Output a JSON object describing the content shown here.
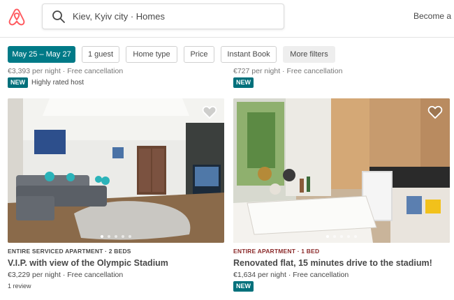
{
  "colors": {
    "brand": "#ff5a5f",
    "accent": "#007a87",
    "badge": "#00707b"
  },
  "header": {
    "logo_icon": "airbnb-logo",
    "search_icon": "search-icon",
    "search_value": "Kiev, Kyiv city · Homes",
    "become_host": "Become a h"
  },
  "filters": {
    "dates": "May 25 – May 27",
    "guests": "1 guest",
    "home_type": "Home type",
    "price": "Price",
    "instant_book": "Instant Book",
    "more_filters": "More filters"
  },
  "prev_listings": [
    {
      "price_line": "€3,393 per night · Free cancellation",
      "badge": "NEW",
      "note": "Highly rated host"
    },
    {
      "price_line": "€727 per night · Free cancellation",
      "badge": "NEW"
    }
  ],
  "listings": [
    {
      "type": "ENTIRE SERVICED APARTMENT · 2 BEDS",
      "type_color": "#484848",
      "title": "V.I.P. with view of the Olympic Stadium",
      "price": "€3,229",
      "price_suffix": "per night · Free cancellation",
      "reviews": "1 review",
      "photo_count": 5,
      "active_photo": 0
    },
    {
      "type": "ENTIRE APARTMENT · 1 BED",
      "type_color": "#8b2a2a",
      "title": "Renovated flat, 15 minutes drive to the stadium!",
      "price": "€1,634",
      "price_suffix": "per night · Free cancellation",
      "badge": "NEW",
      "photo_count": 5,
      "active_photo": 0
    }
  ]
}
